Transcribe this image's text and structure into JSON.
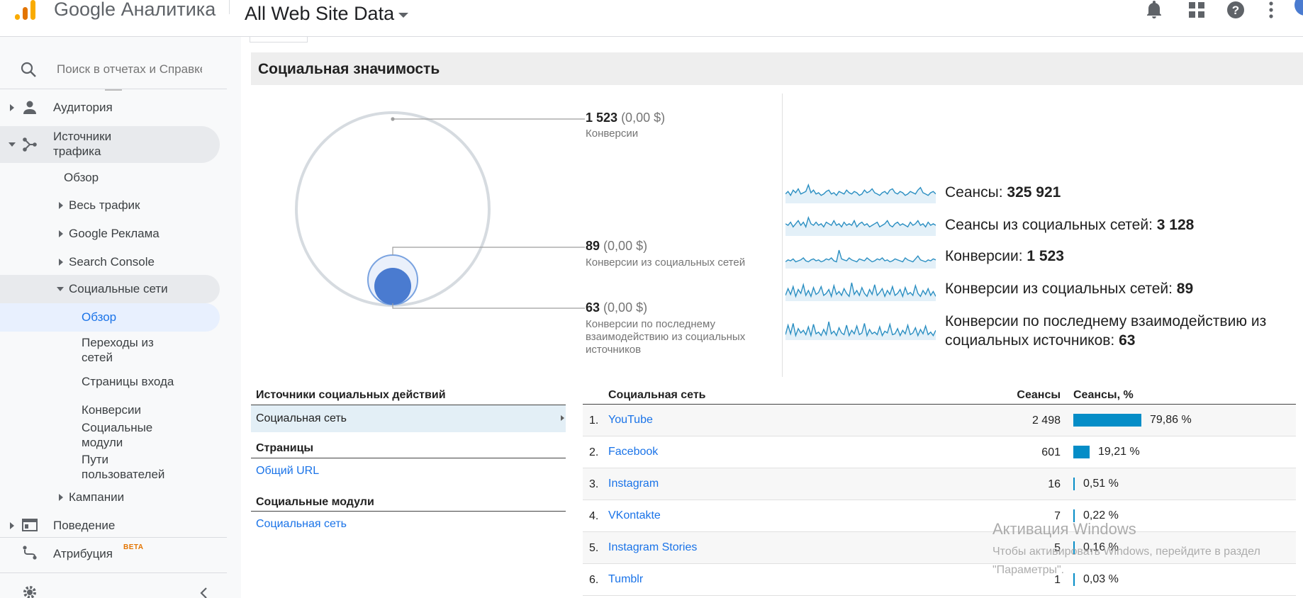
{
  "header": {
    "brand": "Google Аналитика",
    "account": "All Web Site Data"
  },
  "sidebar": {
    "search_placeholder": "Поиск в отчетах и Справке",
    "items": {
      "audience": "Аудитория",
      "acquisition": "Источники трафика",
      "acq_overview": "Обзор",
      "all_traffic": "Весь трафик",
      "google_ads": "Google Реклама",
      "search_console": "Search Console",
      "social": "Социальные сети",
      "social_overview": "Обзор",
      "network_referrals": "Переходы из сетей",
      "landing_pages": "Страницы входа",
      "conversions": "Конверсии",
      "plugins": "Социальные модули",
      "user_flow": "Пути пользователей",
      "campaigns": "Кампании",
      "behavior": "Поведение",
      "attribution": "Атрибуция",
      "beta": "BETA"
    }
  },
  "main": {
    "section_title": "Социальная значимость",
    "bubble": {
      "total": {
        "value": "1 523",
        "money": "(0,00 $)",
        "label": "Конверсии"
      },
      "social": {
        "value": "89",
        "money": "(0,00 $)",
        "label": "Конверсии из социальных сетей"
      },
      "last": {
        "value": "63",
        "money": "(0,00 $)",
        "label": "Конверсии по последнему взаимодействию из социальных источников"
      }
    },
    "sparklines": [
      {
        "label": "Сеансы:",
        "value": "325 921",
        "points": [
          5,
          7,
          4,
          8,
          6,
          9,
          5,
          6,
          7,
          12,
          6,
          8,
          5,
          6,
          4,
          5,
          7,
          8,
          5,
          6,
          4,
          7,
          6,
          5,
          8,
          6,
          5,
          7,
          6,
          4,
          5,
          8,
          6,
          7,
          9,
          6,
          5,
          4,
          6,
          7,
          5,
          8,
          9,
          6,
          5,
          7,
          6,
          4,
          5,
          7,
          6,
          5,
          8,
          10,
          6,
          5,
          4,
          6,
          7,
          5
        ]
      },
      {
        "label": "Сеансы из социальных сетей:",
        "value": "3 128",
        "points": [
          6,
          5,
          7,
          4,
          6,
          8,
          5,
          7,
          4,
          10,
          6,
          5,
          7,
          5,
          6,
          4,
          7,
          6,
          5,
          8,
          5,
          6,
          4,
          7,
          5,
          6,
          5,
          8,
          4,
          6,
          7,
          5,
          6,
          4,
          5,
          6,
          7,
          4,
          5,
          6,
          8,
          5,
          4,
          6,
          7,
          5,
          6,
          5,
          4,
          7,
          5,
          6,
          8,
          5,
          6,
          4,
          7,
          5,
          6,
          5
        ]
      },
      {
        "label": "Конверсии:",
        "value": "1 523",
        "points": [
          4,
          6,
          5,
          7,
          4,
          5,
          6,
          8,
          5,
          4,
          6,
          7,
          5,
          6,
          4,
          5,
          7,
          6,
          8,
          5,
          4,
          16,
          7,
          6,
          5,
          8,
          6,
          5,
          4,
          7,
          6,
          5,
          8,
          6,
          4,
          5,
          7,
          6,
          8,
          5,
          6,
          4,
          5,
          7,
          6,
          5,
          4,
          8,
          6,
          5,
          4,
          7,
          10,
          6,
          5,
          4,
          6,
          5,
          7,
          6
        ]
      },
      {
        "label": "Конверсии из социальных сетей:",
        "value": "89",
        "points": [
          3,
          10,
          4,
          12,
          2,
          9,
          5,
          14,
          3,
          8,
          2,
          11,
          4,
          6,
          12,
          3,
          5,
          9,
          2,
          13,
          4,
          7,
          3,
          10,
          5,
          2,
          16,
          4,
          8,
          3,
          11,
          5,
          2,
          9,
          4,
          14,
          3,
          6,
          10,
          2,
          8,
          4,
          12,
          3,
          5,
          9,
          2,
          11,
          4,
          6,
          3,
          13,
          5,
          2,
          8,
          4,
          10,
          3,
          7,
          2
        ]
      },
      {
        "label": "Конверсии по последнему взаимодействию из социальных источников:",
        "value": "63",
        "points": [
          3,
          14,
          4,
          16,
          2,
          10,
          5,
          8,
          3,
          12,
          2,
          15,
          4,
          6,
          2,
          9,
          3,
          18,
          4,
          7,
          2,
          11,
          5,
          3,
          14,
          2,
          8,
          4,
          13,
          3,
          5,
          16,
          2,
          9,
          4,
          6,
          3,
          12,
          2,
          7,
          5,
          15,
          3,
          4,
          10,
          2,
          8,
          4,
          14,
          3,
          5,
          11,
          2,
          9,
          4,
          13,
          3,
          6,
          2,
          8
        ]
      }
    ],
    "reports": {
      "social_actions_head": "Источники социальных действий",
      "social_network": "Социальная сеть",
      "pages_head": "Страницы",
      "shared_url": "Общий URL",
      "plugins_head": "Социальные модули",
      "plugins_network": "Социальная сеть"
    },
    "table": {
      "headers": {
        "network": "Социальная сеть",
        "sessions": "Сеансы",
        "sessions_pct": "Сеансы, %"
      },
      "rows": [
        {
          "idx": "1.",
          "name": "YouTube",
          "sessions": "2 498",
          "pct": "79,86 %",
          "share": 0.7986
        },
        {
          "idx": "2.",
          "name": "Facebook",
          "sessions": "601",
          "pct": "19,21 %",
          "share": 0.1921
        },
        {
          "idx": "3.",
          "name": "Instagram",
          "sessions": "16",
          "pct": "0,51 %",
          "share": 0.0051
        },
        {
          "idx": "4.",
          "name": "VKontakte",
          "sessions": "7",
          "pct": "0,22 %",
          "share": 0.0022
        },
        {
          "idx": "5.",
          "name": "Instagram Stories",
          "sessions": "5",
          "pct": "0,16 %",
          "share": 0.0016
        },
        {
          "idx": "6.",
          "name": "Tumblr",
          "sessions": "1",
          "pct": "0,03 %",
          "share": 0.0003
        }
      ]
    }
  },
  "watermark": {
    "title": "Активация Windows",
    "subtitle": "Чтобы активировать Windows, перейдите в раздел \"Параметры\"."
  },
  "colors": {
    "accent": "#1a73e8",
    "bar": "#058dc7",
    "bubble": "#4a7bd0",
    "sparkline": "#2b8fc2"
  }
}
